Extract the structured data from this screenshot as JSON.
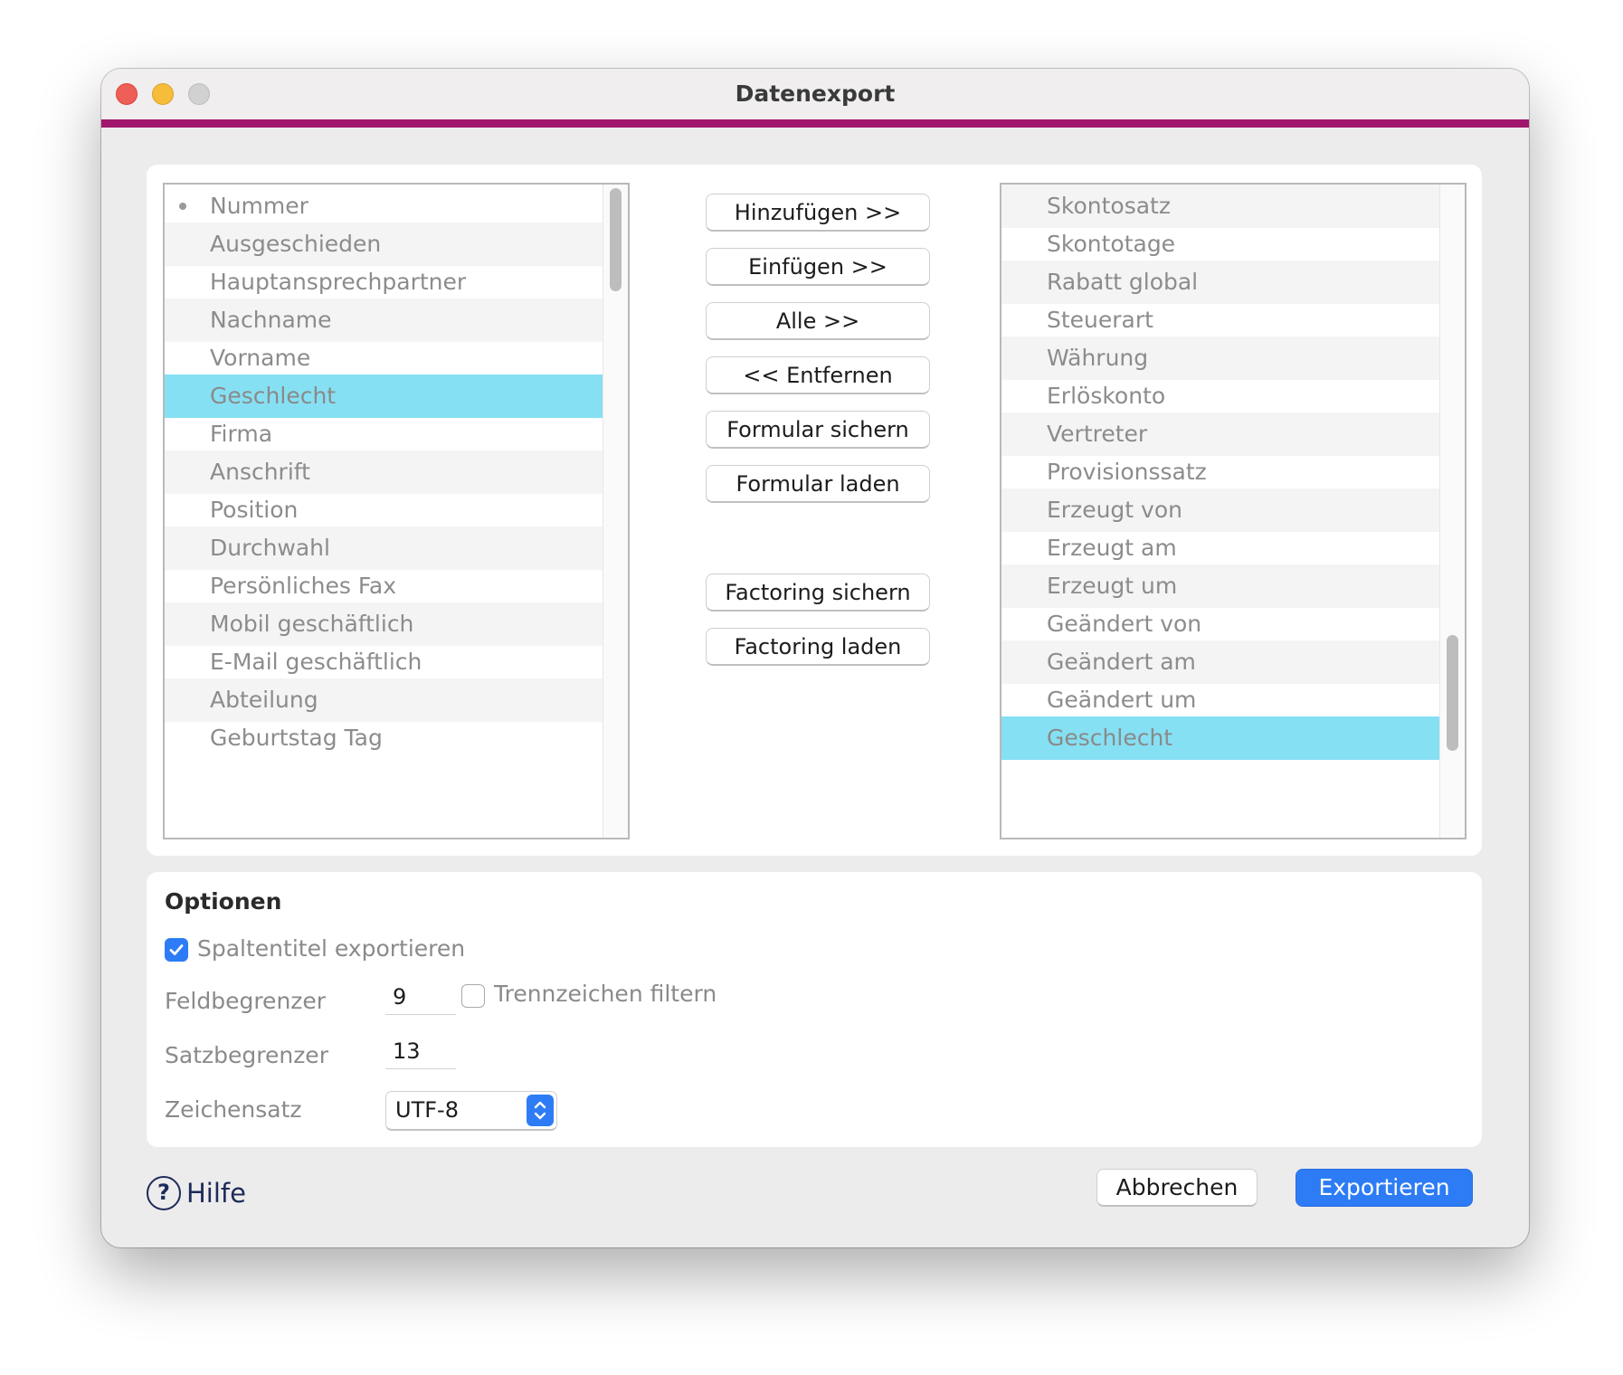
{
  "window": {
    "title": "Datenexport"
  },
  "available_fields": {
    "items": [
      "Nummer",
      "Ausgeschieden",
      "Hauptansprechpartner",
      "Nachname",
      "Vorname",
      "Geschlecht",
      "Firma",
      "Anschrift",
      "Position",
      "Durchwahl",
      "Persönliches Fax",
      "Mobil geschäftlich",
      "E-Mail geschäftlich",
      "Abteilung",
      "Geburtstag Tag"
    ],
    "selected": "Geschlecht"
  },
  "actions": {
    "add": "Hinzufügen >>",
    "insert": "Einfügen >>",
    "all": "Alle >>",
    "remove": "<< Entfernen",
    "save_form": "Formular sichern",
    "load_form": "Formular laden",
    "save_factoring": "Factoring sichern",
    "load_factoring": "Factoring laden"
  },
  "export_fields": {
    "items": [
      "Skontosatz",
      "Skontotage",
      "Rabatt global",
      "Steuerart",
      "Währung",
      "Erlöskonto",
      "Vertreter",
      "Provisionssatz",
      "Erzeugt von",
      "Erzeugt am",
      "Erzeugt um",
      "Geändert von",
      "Geändert am",
      "Geändert um",
      "Geschlecht"
    ],
    "selected": "Geschlecht"
  },
  "options": {
    "heading": "Optionen",
    "export_column_titles": {
      "label": "Spaltentitel exportieren",
      "checked": true
    },
    "field_delimiter": {
      "label": "Feldbegrenzer",
      "value": "9"
    },
    "filter_separators": {
      "label": "Trennzeichen filtern",
      "checked": false
    },
    "record_delimiter": {
      "label": "Satzbegrenzer",
      "value": "13"
    },
    "charset": {
      "label": "Zeichensatz",
      "value": "UTF-8"
    }
  },
  "footer": {
    "help": "Hilfe",
    "cancel": "Abbrechen",
    "export": "Exportieren"
  },
  "colors": {
    "accent_bar": "#a0176d",
    "selection": "#86e0f3",
    "primary_button": "#2d7cf6"
  }
}
